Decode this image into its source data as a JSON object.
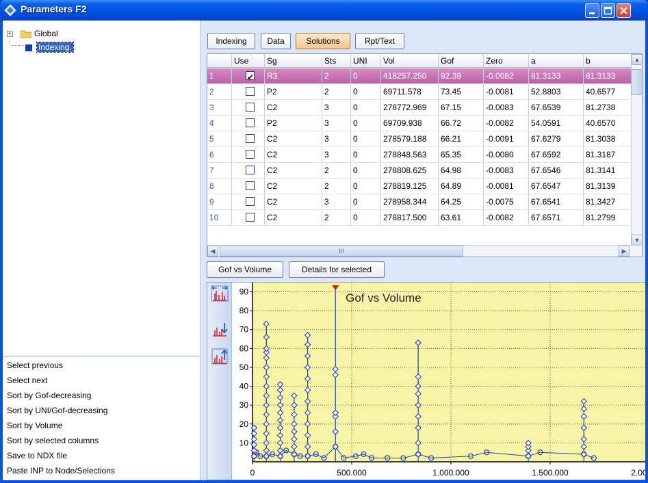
{
  "window": {
    "title": "Parameters F2"
  },
  "tree": {
    "items": [
      {
        "label": "Global",
        "expander": "+"
      },
      {
        "label": "Indexing."
      }
    ]
  },
  "commands": [
    "Select previous",
    "Select next",
    "Sort by Gof-decreasing",
    "Sort by UNI/Gof-decreasing",
    "Sort by Volume",
    "Sort by selected columns",
    "Save to NDX file",
    "Paste INP to Node/Selections"
  ],
  "tabs": [
    "Indexing",
    "Data",
    "Solutions",
    "Rpt/Text"
  ],
  "active_tab": "Solutions",
  "grid": {
    "columns": [
      "",
      "Use",
      "Sg",
      "Sts",
      "UNI",
      "Vol",
      "Gof",
      "Zero",
      "a",
      "b"
    ],
    "rows": [
      {
        "n": "1",
        "use": true,
        "sg": "R3",
        "sts": "2",
        "uni": "0",
        "vol": "418257.250",
        "gof": "92.39",
        "zero": "-0.0082",
        "a": "81.3133",
        "b": "81.3133"
      },
      {
        "n": "2",
        "use": false,
        "sg": "P2",
        "sts": "2",
        "uni": "0",
        "vol": "69711.578",
        "gof": "73.45",
        "zero": "-0.0081",
        "a": "52.8803",
        "b": "40.6577"
      },
      {
        "n": "3",
        "use": false,
        "sg": "C2",
        "sts": "3",
        "uni": "0",
        "vol": "278772.969",
        "gof": "67.15",
        "zero": "-0.0083",
        "a": "67.6539",
        "b": "81.2738"
      },
      {
        "n": "4",
        "use": false,
        "sg": "P2",
        "sts": "3",
        "uni": "0",
        "vol": "69709.938",
        "gof": "66.72",
        "zero": "-0.0082",
        "a": "54.0591",
        "b": "40.6570"
      },
      {
        "n": "5",
        "use": false,
        "sg": "C2",
        "sts": "3",
        "uni": "0",
        "vol": "278579.188",
        "gof": "66.21",
        "zero": "-0.0091",
        "a": "67.6279",
        "b": "81.3038"
      },
      {
        "n": "6",
        "use": false,
        "sg": "C2",
        "sts": "3",
        "uni": "0",
        "vol": "278848.563",
        "gof": "65.35",
        "zero": "-0.0080",
        "a": "67.6592",
        "b": "81.3187"
      },
      {
        "n": "7",
        "use": false,
        "sg": "C2",
        "sts": "2",
        "uni": "0",
        "vol": "278808.625",
        "gof": "64.98",
        "zero": "-0.0083",
        "a": "67.6546",
        "b": "81.3141"
      },
      {
        "n": "8",
        "use": false,
        "sg": "C2",
        "sts": "2",
        "uni": "0",
        "vol": "278819.125",
        "gof": "64.89",
        "zero": "-0.0081",
        "a": "67.6547",
        "b": "81.3139"
      },
      {
        "n": "9",
        "use": false,
        "sg": "C2",
        "sts": "3",
        "uni": "0",
        "vol": "278958.344",
        "gof": "64.25",
        "zero": "-0.0075",
        "a": "67.6541",
        "b": "81.3427"
      },
      {
        "n": "10",
        "use": false,
        "sg": "C2",
        "sts": "2",
        "uni": "0",
        "vol": "278817.500",
        "gof": "63.61",
        "zero": "-0.0082",
        "a": "67.6571",
        "b": "81.2799"
      }
    ],
    "hscroll_grip": "III"
  },
  "chart_tabs": [
    "Gof vs Volume",
    "Details for selected"
  ],
  "colors": {
    "selected_row": "#c06fae",
    "plot_bg": "#f8f4a6",
    "series": "#1f3fb8",
    "marker": "#e0102c"
  },
  "chart_data": {
    "type": "scatter",
    "title": "Gof vs Volume",
    "xlabel": "",
    "ylabel": "",
    "xlim": [
      0,
      2000000
    ],
    "ylim": [
      0,
      92
    ],
    "x_ticks": [
      "0",
      "500.000",
      "1.000.000",
      "1.500.000",
      "2.000.000"
    ],
    "y_ticks": [
      "10",
      "20",
      "30",
      "40",
      "50",
      "60",
      "70",
      "80",
      "90"
    ],
    "grid": true,
    "series": [
      {
        "stems": [
          {
            "x": 8000,
            "values": [
              3,
              6,
              9,
              12,
              15,
              18
            ]
          },
          {
            "x": 70000,
            "values": [
              3,
              6,
              10,
              15,
              20,
              25,
              30,
              35,
              40,
              45,
              50,
              55,
              58,
              60,
              66,
              73
            ]
          },
          {
            "x": 140000,
            "values": [
              3,
              6,
              10,
              14,
              18,
              22,
              26,
              30,
              34,
              38,
              41
            ]
          },
          {
            "x": 210000,
            "values": [
              4,
              8,
              12,
              16,
              20,
              25,
              30,
              35
            ]
          },
          {
            "x": 278000,
            "values": [
              3,
              8,
              14,
              20,
              26,
              32,
              38,
              44,
              50,
              56,
              62,
              67
            ]
          },
          {
            "x": 418000,
            "values": [
              8,
              16,
              24,
              26,
              46,
              49,
              92
            ]
          },
          {
            "x": 835000,
            "values": [
              4,
              10,
              18,
              24,
              30,
              36,
              40,
              45,
              63
            ]
          },
          {
            "x": 1390000,
            "values": [
              3,
              6,
              8,
              10
            ]
          },
          {
            "x": 1670000,
            "values": [
              4,
              8,
              12,
              18,
              24,
              28,
              32
            ]
          }
        ],
        "base_points": [
          {
            "x": 20000,
            "y": 5
          },
          {
            "x": 40000,
            "y": 3
          },
          {
            "x": 100000,
            "y": 4
          },
          {
            "x": 170000,
            "y": 6
          },
          {
            "x": 240000,
            "y": 3
          },
          {
            "x": 320000,
            "y": 4
          },
          {
            "x": 360000,
            "y": 2
          },
          {
            "x": 460000,
            "y": 2
          },
          {
            "x": 520000,
            "y": 3
          },
          {
            "x": 560000,
            "y": 4
          },
          {
            "x": 600000,
            "y": 2
          },
          {
            "x": 680000,
            "y": 2
          },
          {
            "x": 760000,
            "y": 2
          },
          {
            "x": 900000,
            "y": 2
          },
          {
            "x": 1100000,
            "y": 3
          },
          {
            "x": 1180000,
            "y": 5
          },
          {
            "x": 1450000,
            "y": 5
          },
          {
            "x": 1720000,
            "y": 2
          }
        ]
      }
    ]
  }
}
